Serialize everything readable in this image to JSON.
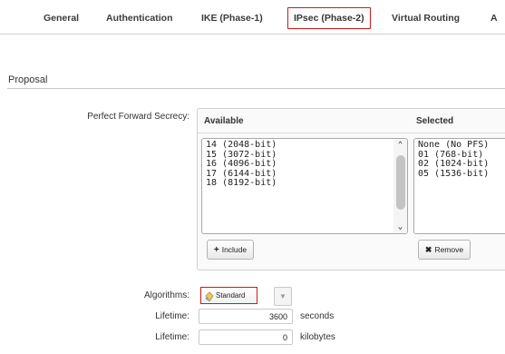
{
  "tabs": [
    {
      "label": "General",
      "active": false
    },
    {
      "label": "Authentication",
      "active": false
    },
    {
      "label": "IKE (Phase-1)",
      "active": false
    },
    {
      "label": "IPsec (Phase-2)",
      "active": true
    },
    {
      "label": "Virtual Routing",
      "active": false
    },
    {
      "label": "A",
      "active": false
    }
  ],
  "section": {
    "title": "Proposal"
  },
  "pfs": {
    "label": "Perfect Forward Secrecy:",
    "available_header": "Available",
    "selected_header": "Selected",
    "available_items": [
      "14 (2048-bit)",
      "15 (3072-bit)",
      "16 (4096-bit)",
      "17 (6144-bit)",
      "18 (8192-bit)"
    ],
    "selected_items": [
      "None (No PFS)",
      "01 (768-bit)",
      "02 (1024-bit)",
      "05 (1536-bit)"
    ],
    "include_label": "Include",
    "remove_label": "Remove"
  },
  "algorithms": {
    "label": "Algorithms:",
    "value": "Standard"
  },
  "lifetime_seconds": {
    "label": "Lifetime:",
    "value": "3600",
    "unit": "seconds"
  },
  "lifetime_kilobytes": {
    "label": "Lifetime:",
    "value": "0",
    "unit": "kilobytes"
  },
  "colors": {
    "highlight": "#d01818"
  }
}
